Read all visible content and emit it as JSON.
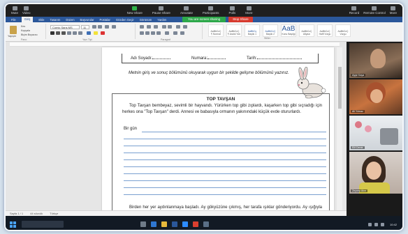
{
  "zoom_toolbar": {
    "left": [
      "Mute",
      "Video"
    ],
    "middle": [
      "New Share",
      "Pause Share",
      "Annotate",
      "Participants",
      "Polls",
      "More"
    ],
    "right": [
      "Record",
      "Remote Control",
      "More"
    ],
    "sharing_banner": "You are screen sharing",
    "stop_share": "Stop Share"
  },
  "ribbon": {
    "tabs": [
      "File",
      "Giriş",
      "Ekle",
      "Tasarım",
      "Düzen",
      "Başvurular",
      "Postalar",
      "Gözden Geçir",
      "Görünüm",
      "Yardım"
    ],
    "active_tab": "Giriş",
    "font_name": "Comic Sans MS",
    "font_size": "11",
    "groups": [
      "Pano",
      "Yazı Tipi",
      "Paragraf",
      "Stiller"
    ],
    "clipboard": [
      "Yapıştır",
      "Kes",
      "Kopyala",
      "Biçim Boyacısı"
    ],
    "styles": [
      {
        "sample": "AaBbCcÇ",
        "label": "¶ Normal"
      },
      {
        "sample": "AaBbCcÇ",
        "label": "¶ Aralık Yok"
      },
      {
        "sample": "AaBbCç",
        "label": "Başlık 1"
      },
      {
        "sample": "AaBbCcÇ",
        "label": "Başlık 2"
      },
      {
        "sample": "AaB",
        "label": "Konu Başlığı"
      },
      {
        "sample": "AaBbCcÇ",
        "label": "Altyazı"
      },
      {
        "sample": "AaBbCcÇ",
        "label": "Hafif Vurgu"
      },
      {
        "sample": "AaBbCcÇ",
        "label": "Vurgu"
      }
    ]
  },
  "document": {
    "info": {
      "name": "Adı Soyadı:",
      "no": "Numara:",
      "date": "Tarih:"
    },
    "instruction": "Metnin giriş ve sonuç bölümünü okuyarak uygun bir şekilde gelişme bölümünü yazınız.",
    "story_title": "TOP TAVŞAN",
    "story_intro": "Top Tavşan bembeyaz, sevimli bir hayvandı. Yürürken top gibi zıplardı, kaşarken top gibi sıçradığı için herkes ona \"Top Tavşan\" derdi. Annesi ve babasıyla ormanın yakınındaki küçük evde otururlardı.",
    "story_start": "Bir gün",
    "story_end": "Birden her yer aydınlanmaya başladı. Ay gökyüzüne çıkmış, her tarafa ışıklar gönderiyordu. Ay ışığıyla evinin yolunu buldu. Koşarak evine döndü. Merakla bekleyen"
  },
  "statusbar": [
    "Sayfa 1 / 1",
    "44 sözcük",
    "Türkçe"
  ],
  "participants": [
    {
      "name": "Ayşe Kaya",
      "bg": "#6d5a4a"
    },
    {
      "name": "Ali Yılmaz",
      "bg": "#b86a3a"
    },
    {
      "name": "Elif Demir",
      "bg": "#dfe2e6"
    },
    {
      "name": "Zeynep Akın",
      "bg": "#cfc6c0"
    }
  ],
  "clock": "10:42",
  "colors": {
    "ribbon_blue": "#2b579a",
    "share_green": "#2da84a",
    "stop_red": "#d73a2e"
  }
}
